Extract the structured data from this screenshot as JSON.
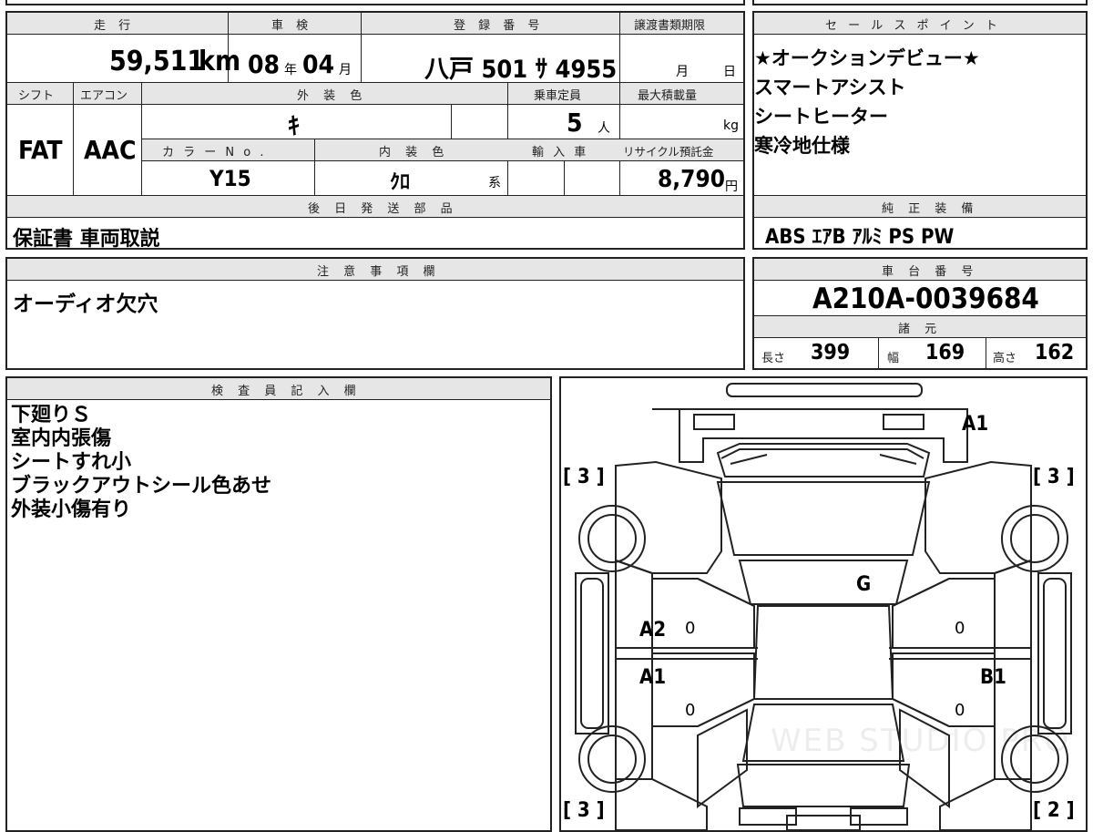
{
  "header": {
    "mileage_label": "走 行",
    "mileage": "59,511",
    "mileage_unit": "km",
    "inspection_label": "車 検",
    "inspection_year": "08",
    "inspection_year_unit": "年",
    "inspection_month": "04",
    "inspection_month_unit": "月",
    "registration_label": "登 録 番 号",
    "registration": "八戸  501 ｻ 4955",
    "transfer_label": "譲渡書類期限",
    "transfer_month_unit": "月",
    "transfer_day_unit": "日"
  },
  "specs": {
    "shift_label": "シフト",
    "shift": "FAT",
    "ac_label": "エアコン",
    "ac": "AAC",
    "exterior_label": "外 装 色",
    "exterior_color": "ｷ",
    "capacity_label": "乗車定員",
    "capacity": "5",
    "capacity_unit": "人",
    "max_load_label": "最大積載量",
    "max_load_unit": "kg",
    "color_no_label": "カ ラ ー N o .",
    "color_no": "Y15",
    "interior_label": "内 装 色",
    "interior_color": "ｸﾛ",
    "interior_suffix": "系",
    "import_label": "輸 入 車",
    "recycle_label": "リサイクル預託金",
    "recycle_fee": "8,790",
    "recycle_unit": "円"
  },
  "later_parts": {
    "label": "後 日 発 送 部 品",
    "value": "保証書 車両取説"
  },
  "sales_points": {
    "label": "セ ー ル ス ポ イ ン ト",
    "items": [
      "★オークションデビュー★",
      "スマートアシスト",
      "シートヒーター",
      "寒冷地仕様"
    ]
  },
  "equipment": {
    "label": "純 正 装 備",
    "value": "ABS  ｴｱB  ｱﾙﾐ  PS  PW"
  },
  "notes": {
    "label": "注 意 事 項 欄",
    "value": "オーディオ欠穴"
  },
  "chassis": {
    "label": "車 台 番 号",
    "value": "A210A-0039684",
    "dims_label": "諸 元",
    "length_label": "長さ",
    "length": "399",
    "width_label": "幅",
    "width": "169",
    "height_label": "高さ",
    "height": "162"
  },
  "inspector": {
    "label": "検 査 員 記 入 欄",
    "items": [
      "下廻りＳ",
      "室内内張傷",
      "シートすれ小",
      "ブラックアウトシール色あせ",
      "外装小傷有り"
    ]
  },
  "diagram": {
    "marks": {
      "front_right": "A1",
      "roof": "G",
      "left_front_door": "A2",
      "left_rear_door": "A1",
      "right_rear_door": "B1",
      "door_zeros": [
        "0",
        "0",
        "0",
        "0"
      ],
      "tire_fl": "[ 3 ]",
      "tire_fr": "[ 3 ]",
      "tire_rl": "[ 3 ]",
      "tire_rr": "[ 2 ]"
    },
    "watermark": "WEB STUDIO PRO"
  }
}
